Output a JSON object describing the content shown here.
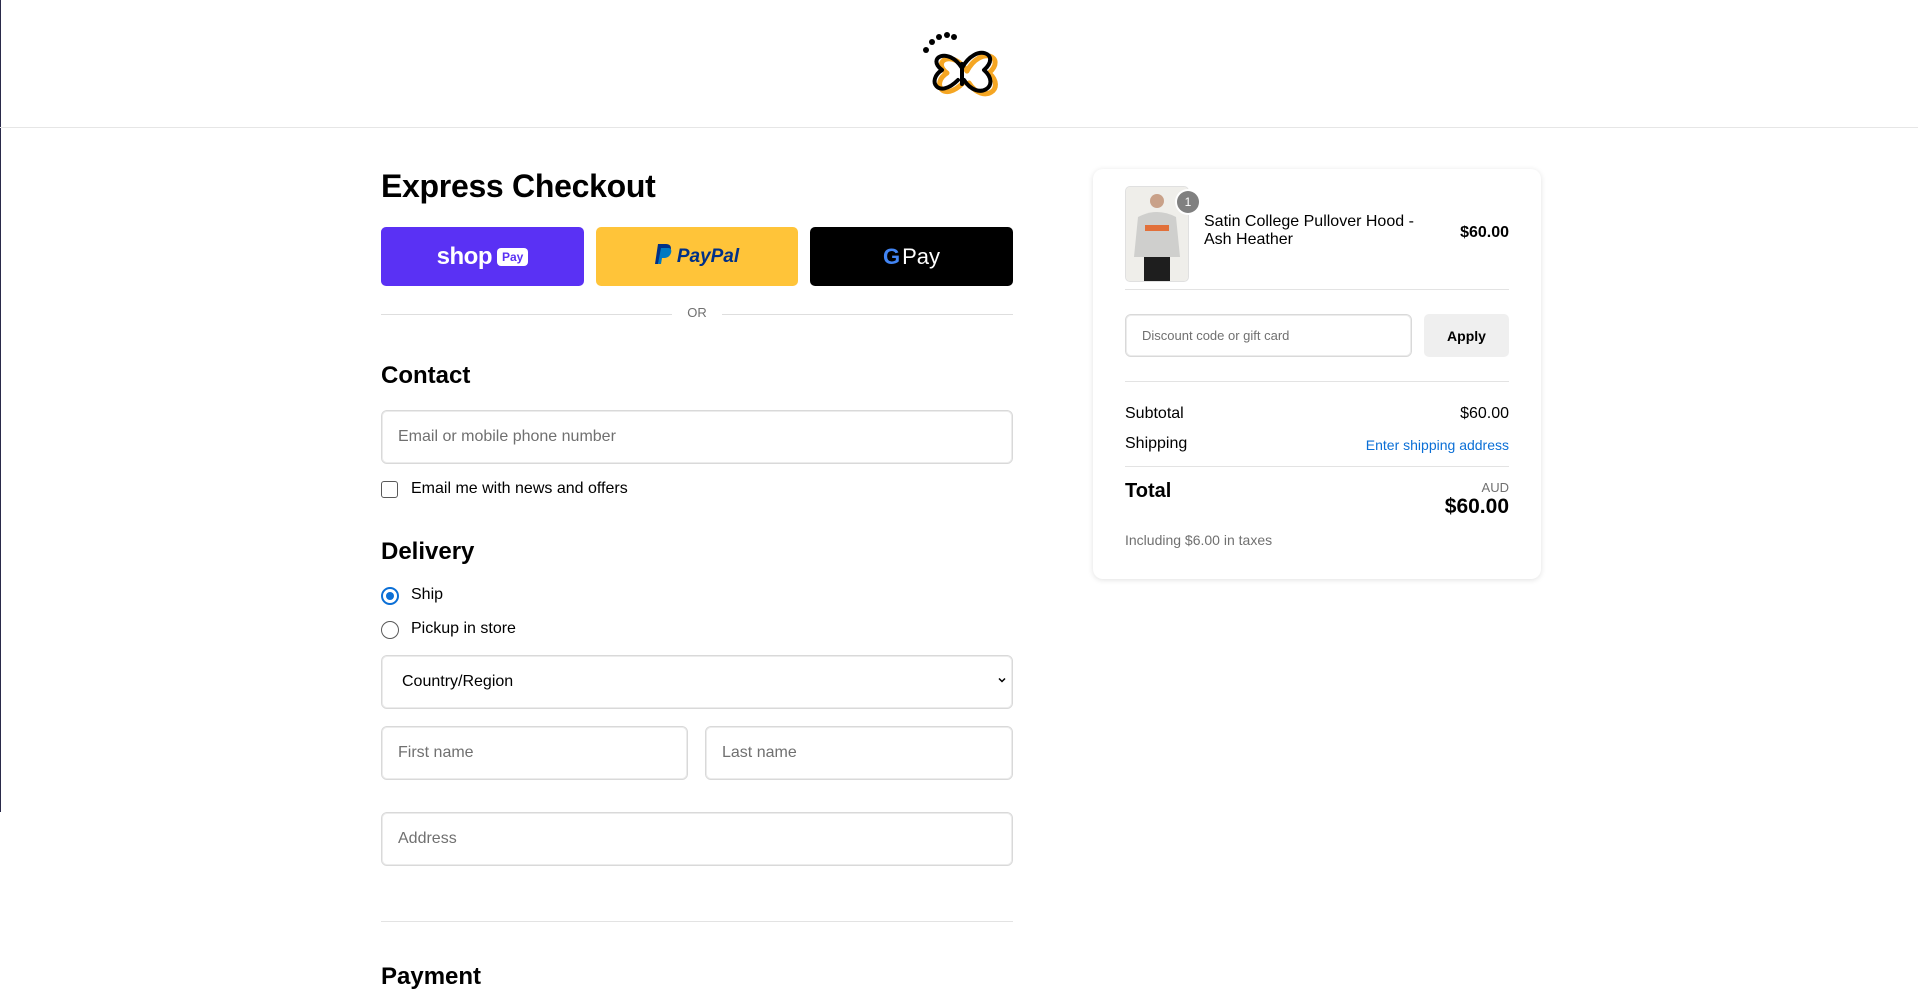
{
  "header": {
    "logo_name": "butterfly-logo"
  },
  "express": {
    "title": "Express Checkout",
    "shop_label": "shop",
    "shop_badge": "Pay",
    "paypal_label": "PayPal",
    "gpay_label": "Pay",
    "or_label": "OR",
    "colors": {
      "shop": "#5a31f4",
      "paypal": "#ffc439",
      "gpay": "#000000"
    }
  },
  "contact": {
    "title": "Contact",
    "email_placeholder": "Email or mobile phone number",
    "newsletter_label": "Email me with news and offers",
    "newsletter_checked": false
  },
  "delivery": {
    "title": "Delivery",
    "options": [
      {
        "label": "Ship",
        "selected": true
      },
      {
        "label": "Pickup in store",
        "selected": false
      }
    ],
    "country_label": "Country/Region",
    "first_name_placeholder": "First name",
    "last_name_placeholder": "Last name",
    "address_placeholder": "Address"
  },
  "payment": {
    "title": "Payment"
  },
  "summary": {
    "product": {
      "name": "Satin College Pullover Hood - Ash Heather",
      "price": "$60.00",
      "quantity": "1"
    },
    "discount_placeholder": "Discount code or gift card",
    "apply_label": "Apply",
    "subtotal_label": "Subtotal",
    "subtotal_value": "$60.00",
    "shipping_label": "Shipping",
    "shipping_value": "Enter shipping address",
    "total_label": "Total",
    "currency": "AUD",
    "total_value": "$60.00",
    "taxes_note": "Including $6.00 in taxes",
    "accent_color": "#0b6fd6"
  }
}
